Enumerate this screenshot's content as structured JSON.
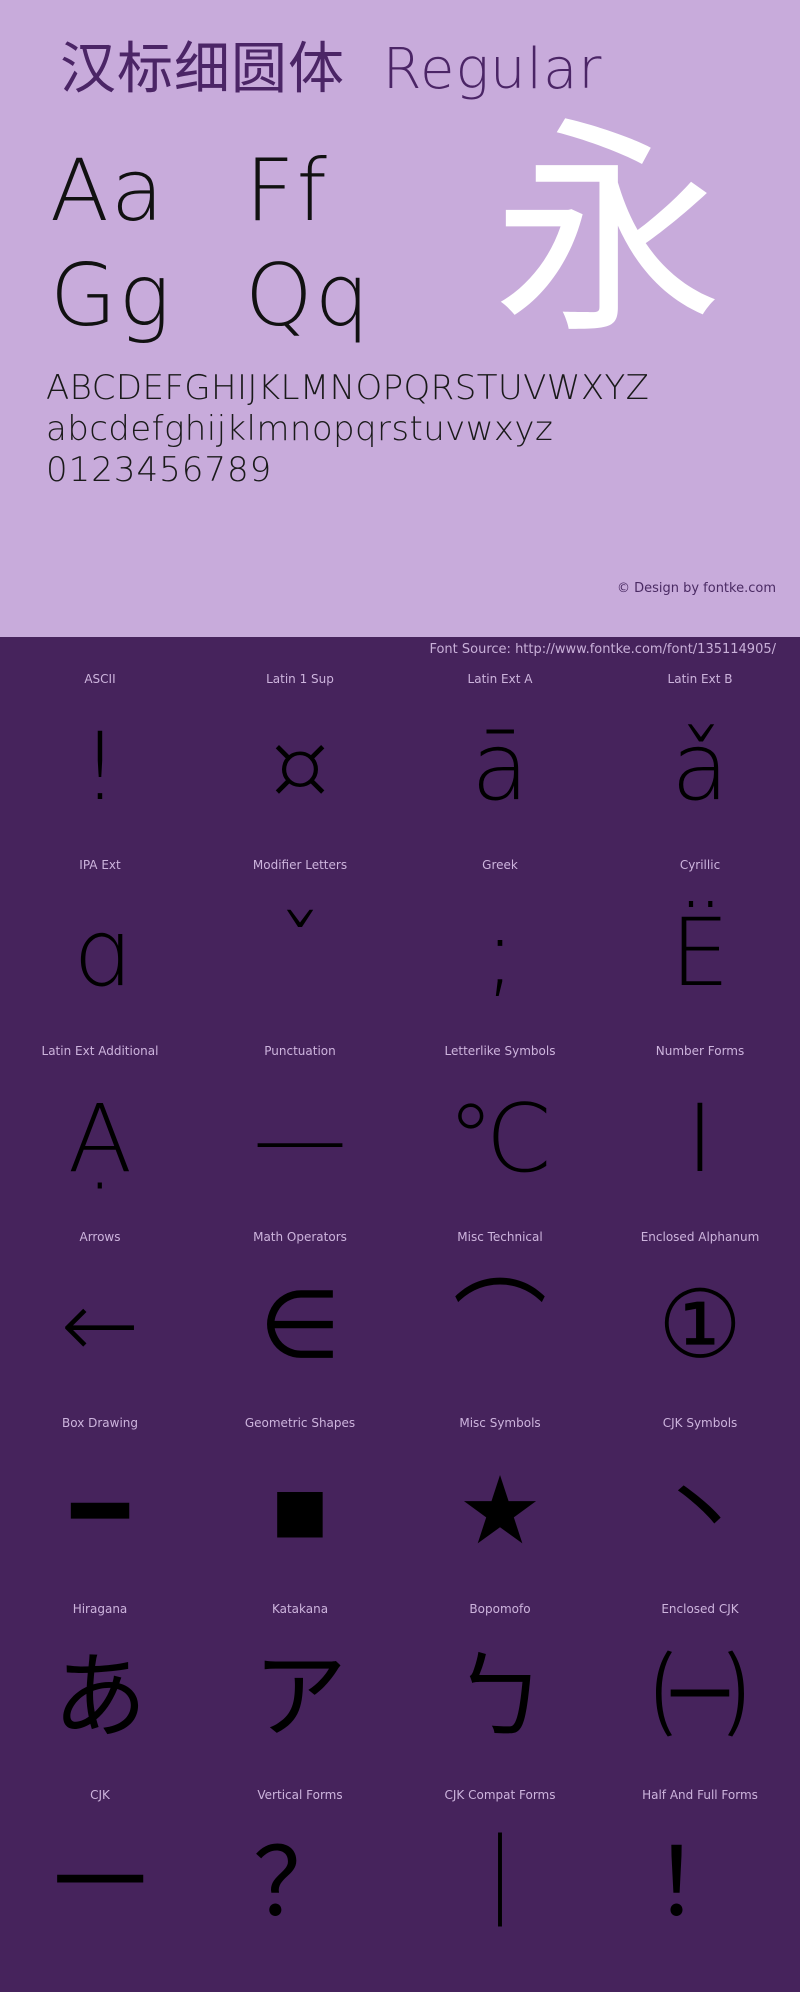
{
  "specimen": {
    "title": "汉标细圆体  Regular",
    "sample_pairs": [
      [
        "Aa",
        "Ff"
      ],
      [
        "Gg",
        "Qq"
      ]
    ],
    "hanzi_sample": "永",
    "uppercase_line": "ABCDEFGHIJKLMNOPQRSTUVWXYZ",
    "lowercase_line": "abcdefghijklmnopqrstuvwxyz",
    "digits_line": "0123456789",
    "copyright": "© Design by fontke.com",
    "source": "Font Source: http://www.fontke.com/font/135114905/"
  },
  "colors": {
    "panel_bg": "#c8abdb",
    "dark_bg": "#46235c",
    "label_text": "#cdb4dd",
    "title_text": "#4b2566",
    "glyph_black": "#000000",
    "glyph_white": "#ffffff"
  },
  "blocks": [
    {
      "label": "ASCII",
      "glyph": "!"
    },
    {
      "label": "Latin 1 Sup",
      "glyph": "¤"
    },
    {
      "label": "Latin Ext A",
      "glyph": "ā"
    },
    {
      "label": "Latin Ext B",
      "glyph": "ǎ"
    },
    {
      "label": "IPA Ext",
      "glyph": "ɑ"
    },
    {
      "label": "Modifier Letters",
      "glyph": "ˇ"
    },
    {
      "label": "Greek",
      "glyph": ";"
    },
    {
      "label": "Cyrillic",
      "glyph": "Ё"
    },
    {
      "label": "Latin Ext Additional",
      "glyph": "Ạ"
    },
    {
      "label": "Punctuation",
      "glyph": "—"
    },
    {
      "label": "Letterlike Symbols",
      "glyph": "℃"
    },
    {
      "label": "Number Forms",
      "glyph": "Ⅰ"
    },
    {
      "label": "Arrows",
      "glyph": "←"
    },
    {
      "label": "Math Operators",
      "glyph": "∈"
    },
    {
      "label": "Misc Technical",
      "glyph": "⌒"
    },
    {
      "label": "Enclosed Alphanum",
      "glyph": "①"
    },
    {
      "label": "Box Drawing",
      "glyph": "━"
    },
    {
      "label": "Geometric Shapes",
      "glyph": "■"
    },
    {
      "label": "Misc Symbols",
      "glyph": "★"
    },
    {
      "label": "CJK Symbols",
      "glyph": "丶"
    },
    {
      "label": "Hiragana",
      "glyph": "あ"
    },
    {
      "label": "Katakana",
      "glyph": "ア"
    },
    {
      "label": "Bopomofo",
      "glyph": "ㄅ"
    },
    {
      "label": "Enclosed CJK",
      "glyph": "㈠"
    },
    {
      "label": "CJK",
      "glyph": "一"
    },
    {
      "label": "Vertical Forms",
      "glyph": "？"
    },
    {
      "label": "CJK Compat Forms",
      "glyph": "｜"
    },
    {
      "label": "Half And Full Forms",
      "glyph": "！"
    }
  ]
}
